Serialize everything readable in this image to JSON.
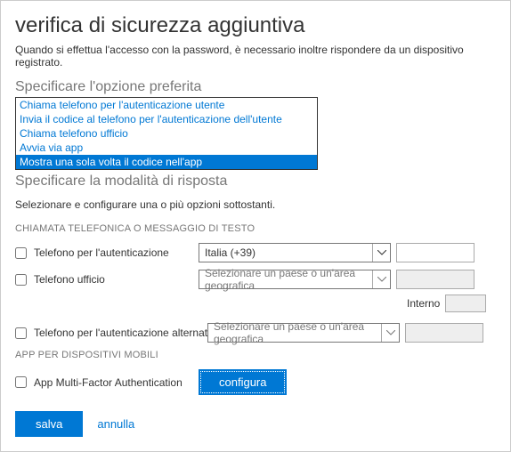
{
  "header": {
    "title": "verifica di sicurezza aggiuntiva",
    "subtitle": "Quando si effettua l'accesso con la password, è necessario inoltre rispondere da un dispositivo registrato."
  },
  "preferred": {
    "heading": "Specificare l'opzione preferita",
    "options": [
      "Chiama telefono per l'autenticazione utente",
      "Invia il codice al telefono per l'autenticazione dell'utente",
      "Chiama telefono ufficio",
      "Avvia via app",
      "Mostra una sola volta il codice nell'app"
    ],
    "selected_index": 4
  },
  "response": {
    "heading": "Specificare la modalità di risposta",
    "help": "Selezionare e configurare una o più opzioni sottostanti.",
    "phone_section_label": "CHIAMATA TELEFONICA O MESSAGGIO DI TESTO",
    "rows": {
      "auth_phone": {
        "label": "Telefono per l'autenticazione",
        "country": "Italia (+39)"
      },
      "office_phone": {
        "label": "Telefono ufficio",
        "country": "Selezionare un paese o un'area geografica",
        "ext_label": "Interno"
      },
      "alt_phone": {
        "label": "Telefono per l'autenticazione alternativo",
        "country": "Selezionare un paese o un'area geografica"
      }
    },
    "app_section_label": "APP PER DISPOSITIVI MOBILI",
    "app_row": {
      "label": "App Multi-Factor Authentication",
      "configure": "configura"
    }
  },
  "actions": {
    "save": "salva",
    "cancel": "annulla"
  }
}
